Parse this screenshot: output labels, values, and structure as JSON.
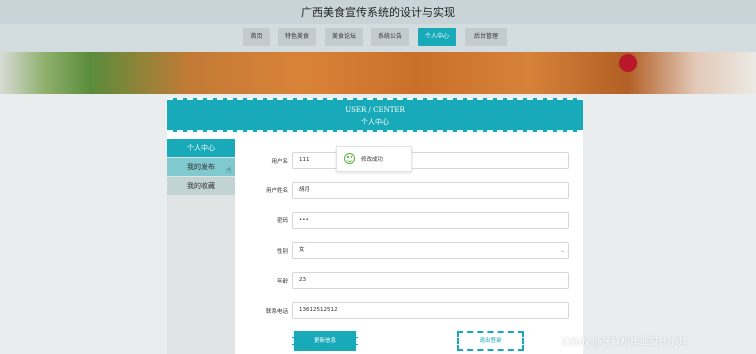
{
  "site_title": "广西美食宣传系统的设计与实现",
  "nav": {
    "items": [
      {
        "label": "首页"
      },
      {
        "label": "特色美食"
      },
      {
        "label": "美食论坛"
      },
      {
        "label": "系统公告"
      },
      {
        "label": "个人中心",
        "active": true
      },
      {
        "label": "后台管理"
      }
    ]
  },
  "center_header": {
    "en": "USER / CENTER",
    "cn": "个人中心"
  },
  "sidebar": {
    "items": [
      {
        "label": "个人中心",
        "state": "active"
      },
      {
        "label": "我的发布",
        "state": "hover"
      },
      {
        "label": "我的收藏",
        "state": "normal"
      }
    ]
  },
  "toast": {
    "text": "修改成功",
    "icon": "smile-icon",
    "color": "#55b23a"
  },
  "form": {
    "username": {
      "label": "用户名",
      "value": "111"
    },
    "name": {
      "label": "用户姓名",
      "value": "胡月"
    },
    "password": {
      "label": "密码",
      "value": "•••"
    },
    "gender": {
      "label": "性别",
      "value": "女"
    },
    "age": {
      "label": "年龄",
      "value": "23"
    },
    "phone": {
      "label": "联系电话",
      "value": "13612512512"
    }
  },
  "buttons": {
    "update": "更新信息",
    "logout": "退出登录"
  },
  "watermark": "CSDN @计算机毕业设计小帅",
  "colors": {
    "accent": "#18aab8"
  }
}
